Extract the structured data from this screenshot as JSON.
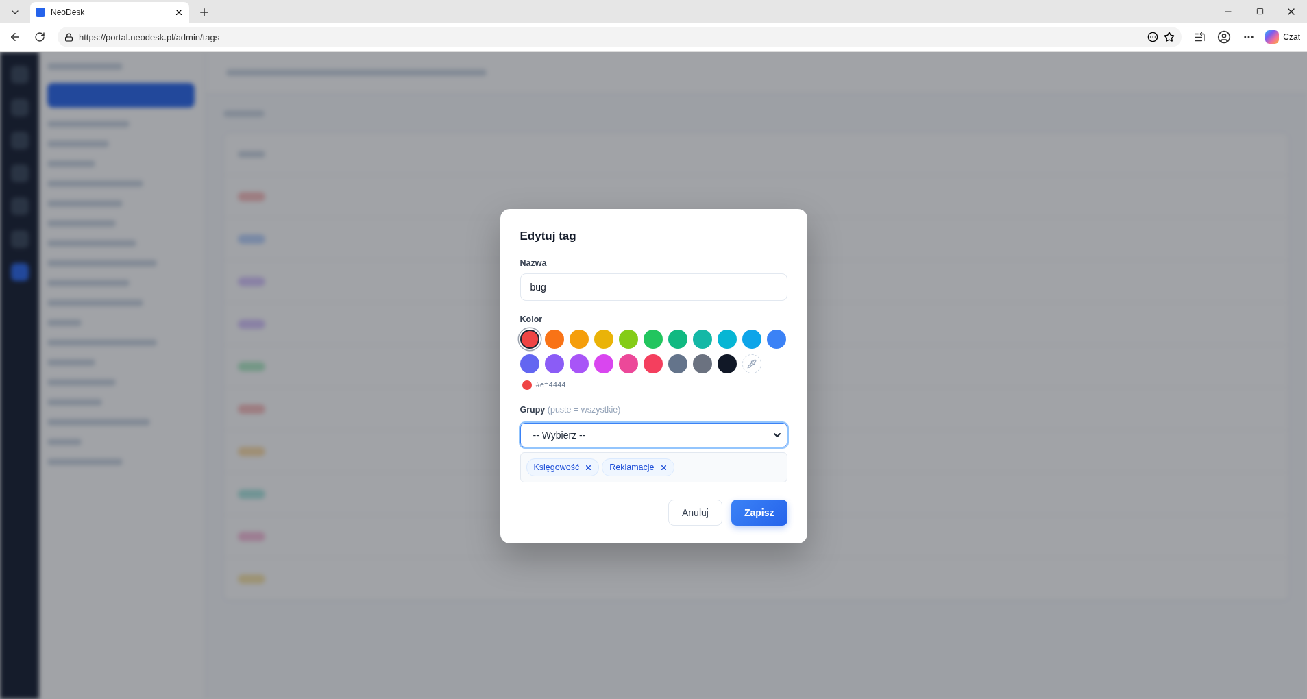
{
  "browser": {
    "tab_title": "NeoDesk",
    "url": "https://portal.neodesk.pl/admin/tags",
    "copilot_label": "Czat"
  },
  "dialog": {
    "title": "Edytuj tag",
    "name_label": "Nazwa",
    "name_value": "bug",
    "color_label": "Kolor",
    "swatches": [
      {
        "color": "#ef4444",
        "selected": true
      },
      {
        "color": "#f97316",
        "selected": false
      },
      {
        "color": "#f59e0b",
        "selected": false
      },
      {
        "color": "#eab308",
        "selected": false
      },
      {
        "color": "#84cc16",
        "selected": false
      },
      {
        "color": "#22c55e",
        "selected": false
      },
      {
        "color": "#10b981",
        "selected": false
      },
      {
        "color": "#14b8a6",
        "selected": false
      },
      {
        "color": "#06b6d4",
        "selected": false
      },
      {
        "color": "#0ea5e9",
        "selected": false
      },
      {
        "color": "#3b82f6",
        "selected": false
      },
      {
        "color": "#6366f1",
        "selected": false
      },
      {
        "color": "#8b5cf6",
        "selected": false
      },
      {
        "color": "#a855f7",
        "selected": false
      },
      {
        "color": "#d946ef",
        "selected": false
      },
      {
        "color": "#ec4899",
        "selected": false
      },
      {
        "color": "#f43f5e",
        "selected": false
      },
      {
        "color": "#64748b",
        "selected": false
      },
      {
        "color": "#6b7280",
        "selected": false
      },
      {
        "color": "#111827",
        "selected": false
      }
    ],
    "hex_value": "#ef4444",
    "groups_label": "Grupy",
    "groups_hint": "(puste = wszystkie)",
    "groups_select": "-- Wybierz --",
    "chips": [
      {
        "label": "Księgowość"
      },
      {
        "label": "Reklamacje"
      }
    ],
    "buttons": [
      {
        "label": "Anuluj",
        "kind": "secondary"
      },
      {
        "label": "Zapisz",
        "kind": "primary"
      }
    ]
  }
}
